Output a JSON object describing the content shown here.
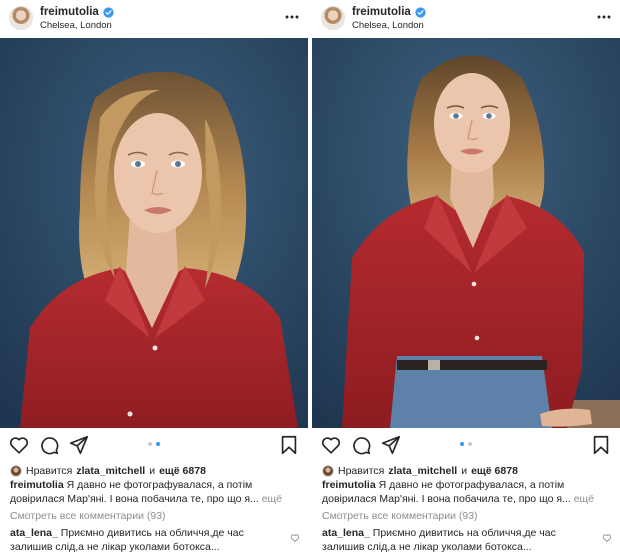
{
  "posts": [
    {
      "username": "freimutolia",
      "location": "Chelsea, London",
      "likes_prefix": "Нравится",
      "liker": "zlata_mitchell",
      "likes_joiner": "и",
      "likes_count": "ещё 6878",
      "caption_user": "freimutolia",
      "caption_text": "Я давно не фотографувалася, а потім довірилася Мар'яні. І вона побачила те, про що я...",
      "caption_more": "ещё",
      "view_all": "Смотреть все комментарии (93)",
      "comment_user": "ata_lena_",
      "comment_text": "Приємно дивитись на обличчя,де час залишив слід,а не лікар уколами ботокса...",
      "carousel_active": 2,
      "carousel_total": 2
    },
    {
      "username": "freimutolia",
      "location": "Chelsea, London",
      "likes_prefix": "Нравится",
      "liker": "zlata_mitchell",
      "likes_joiner": "и",
      "likes_count": "ещё 6878",
      "caption_user": "freimutolia",
      "caption_text": "Я давно не фотографувалася, а потім довірилася Мар'яні. І вона побачила те, про що я...",
      "caption_more": "ещё",
      "view_all": "Смотреть все комментарии (93)",
      "comment_user": "ata_lena_",
      "comment_text": "Приємно дивитись на обличчя,де час залишив слід,а не лікар уколами ботокса...",
      "carousel_active": 1,
      "carousel_total": 2
    }
  ],
  "icons": [
    "verified-badge-icon",
    "more-options-icon",
    "like-icon",
    "comment-icon",
    "share-icon",
    "save-icon",
    "comment-like-icon"
  ],
  "colors": {
    "backdrop": "#2c4a66",
    "shirt": "#a8262a",
    "hair": "#b58a52",
    "skin": "#e8c2a8",
    "verified": "#3897f0",
    "muted_text": "#8e8e8e"
  }
}
